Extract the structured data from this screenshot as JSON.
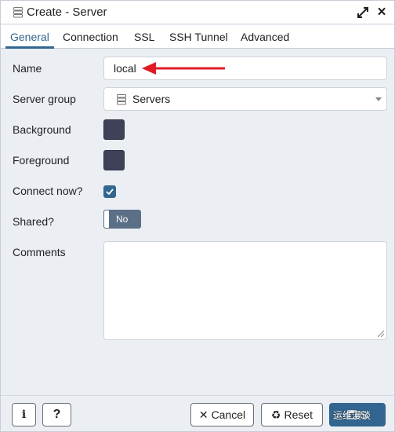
{
  "window": {
    "title": "Create - Server"
  },
  "tabs": [
    {
      "label": "General",
      "active": true
    },
    {
      "label": "Connection",
      "active": false
    },
    {
      "label": "SSL",
      "active": false
    },
    {
      "label": "SSH Tunnel",
      "active": false
    },
    {
      "label": "Advanced",
      "active": false
    }
  ],
  "form": {
    "name": {
      "label": "Name",
      "value": "local"
    },
    "server_group": {
      "label": "Server group",
      "value": "Servers"
    },
    "background": {
      "label": "Background",
      "color": "#3f4158"
    },
    "foreground": {
      "label": "Foreground",
      "color": "#3f4158"
    },
    "connect_now": {
      "label": "Connect now?",
      "checked": true
    },
    "shared": {
      "label": "Shared?",
      "state": "No"
    },
    "comments": {
      "label": "Comments",
      "value": ""
    }
  },
  "footer": {
    "info_label": "i",
    "help_label": "?",
    "cancel_label": "Cancel",
    "reset_label": "Reset",
    "save_label": "S",
    "watermark": "运维漫谈"
  },
  "colors": {
    "accent": "#326690",
    "annotation_arrow": "#e01b24"
  }
}
